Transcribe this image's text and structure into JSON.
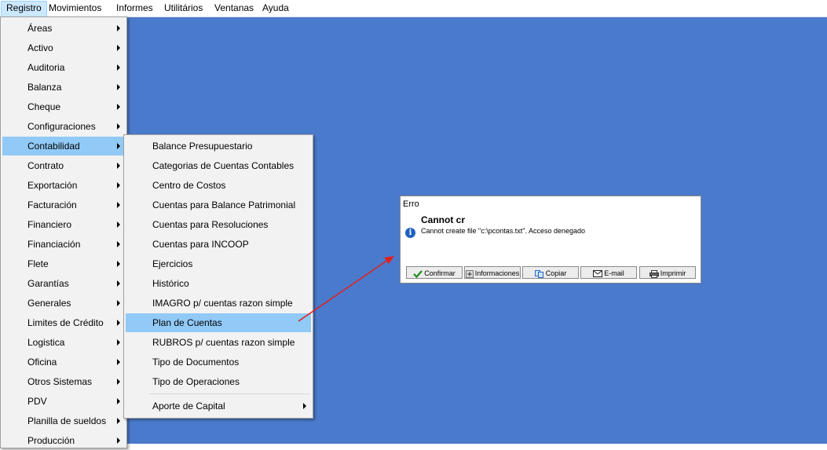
{
  "menubar": {
    "items": [
      "Registro",
      "Movimientos",
      "Informes",
      "Utilitários",
      "Ventanas",
      "Ayuda"
    ]
  },
  "registro_menu": {
    "items": [
      "Áreas",
      "Activo",
      "Auditoria",
      "Balanza",
      "Cheque",
      "Configuraciones",
      "Contabilidad",
      "Contrato",
      "Exportación",
      "Facturación",
      "Financiero",
      "Financiación",
      "Flete",
      "Garantías",
      "Generales",
      "Limites de Crédito",
      "Logistica",
      "Oficina",
      "Otros Sistemas",
      "PDV",
      "Planilla de sueldos",
      "Producción"
    ],
    "highlighted": "Contabilidad"
  },
  "contabilidad_menu": {
    "items": [
      "Balance Presupuestario",
      "Categorias de Cuentas Contables",
      "Centro de Costos",
      "Cuentas para Balance Patrimonial",
      "Cuentas para Resoluciones",
      "Cuentas para INCOOP",
      "Ejercicios",
      "Histórico",
      "IMAGRO p/ cuentas razon simple",
      "Plan de Cuentas",
      "RUBROS p/ cuentas razon simple",
      "Tipo de Documentos",
      "Tipo de Operaciones"
    ],
    "aporte": "Aporte de Capital",
    "highlighted": "Plan de Cuentas"
  },
  "dialog": {
    "title": "Erro",
    "heading": "Cannot cr",
    "message": "Cannot create file \"c:\\pcontas.txt\". Acceso denegado",
    "buttons": [
      "Confirmar",
      "Informaciones",
      "Copiar",
      "E-mail",
      "Imprimir"
    ]
  },
  "colors": {
    "desktop": "#4a7acb",
    "highlight": "#91c9f7",
    "arrow": "#e02020"
  }
}
